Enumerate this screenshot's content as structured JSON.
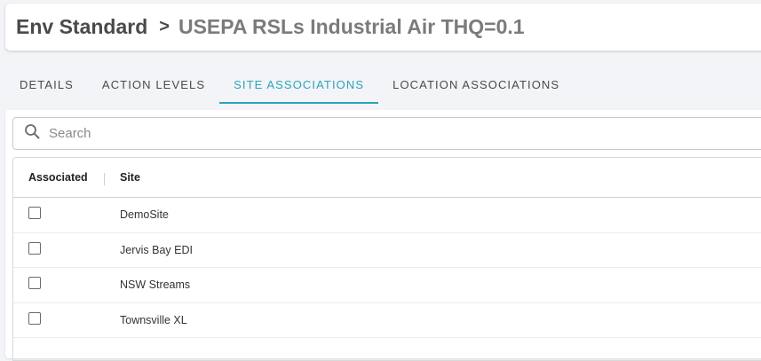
{
  "breadcrumb": {
    "root": "Env Standard",
    "separator": ">",
    "current": "USEPA RSLs Industrial Air THQ=0.1"
  },
  "tabs": [
    {
      "label": "Details",
      "active": false
    },
    {
      "label": "Action Levels",
      "active": false
    },
    {
      "label": "Site Associations",
      "active": true
    },
    {
      "label": "Location Associations",
      "active": false
    }
  ],
  "search": {
    "placeholder": "Search",
    "value": ""
  },
  "table": {
    "columns": [
      "Associated",
      "Site"
    ],
    "rows": [
      {
        "associated": false,
        "site": "DemoSite"
      },
      {
        "associated": false,
        "site": "Jervis Bay EDI"
      },
      {
        "associated": false,
        "site": "NSW Streams"
      },
      {
        "associated": false,
        "site": "Townsville XL"
      }
    ]
  },
  "colors": {
    "accent": "#2aa5b8",
    "background": "#f3f4f8"
  }
}
